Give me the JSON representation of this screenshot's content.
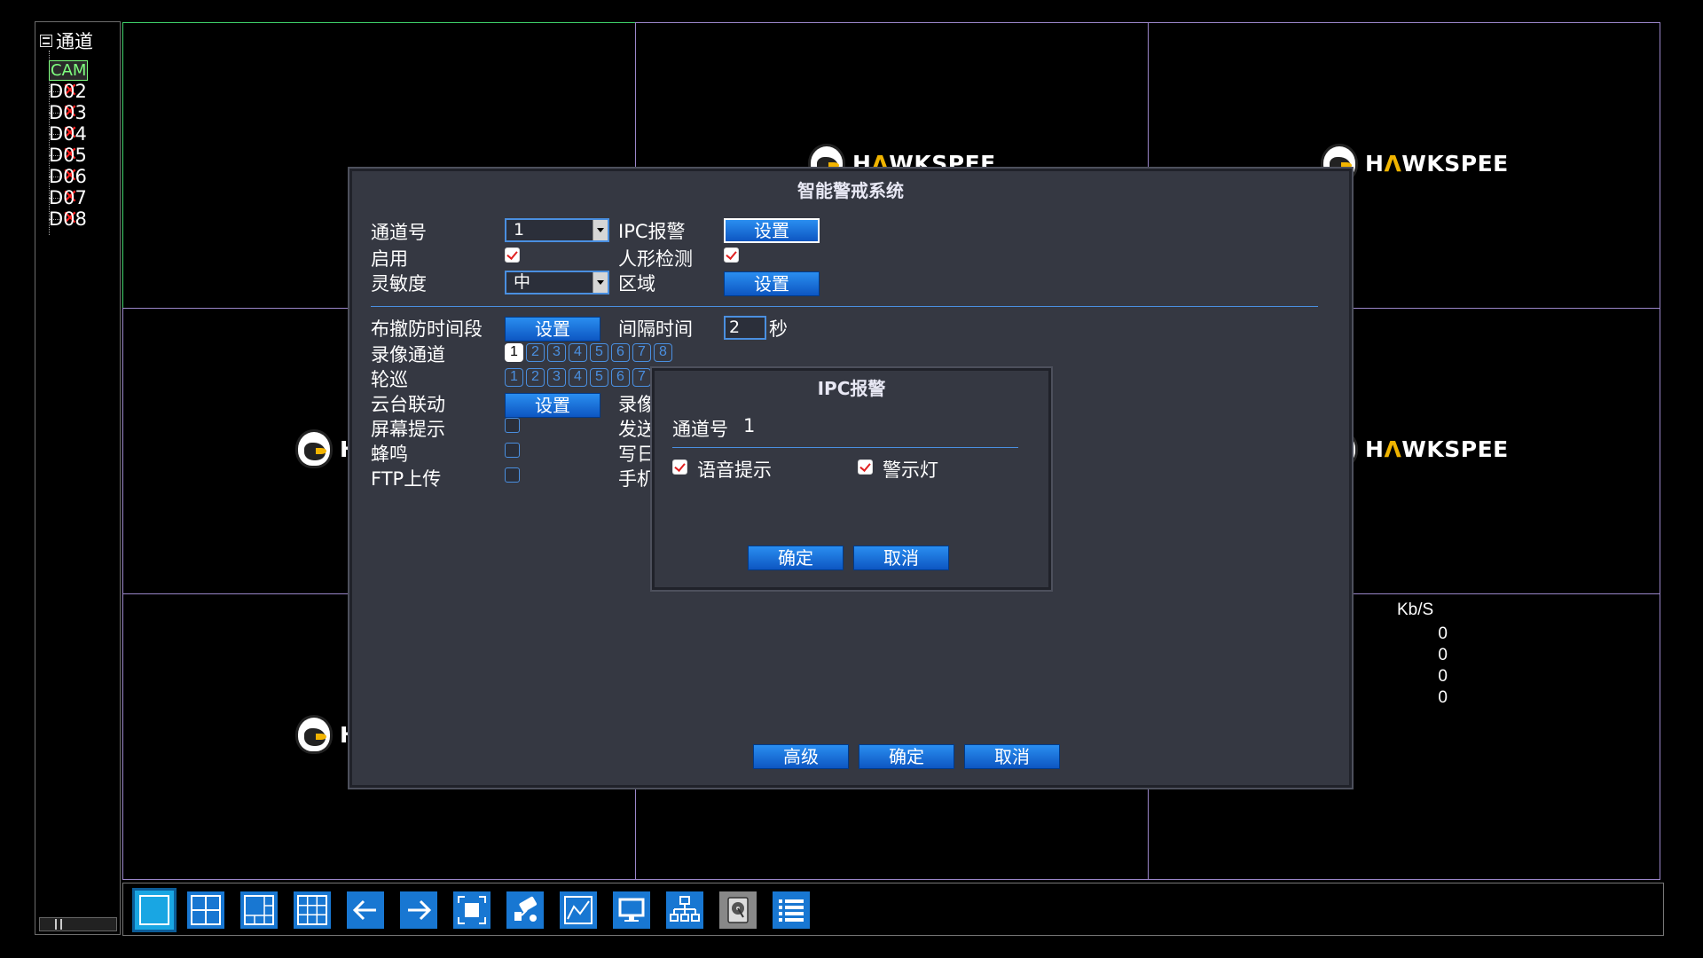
{
  "tree": {
    "root_label": "通道",
    "items": [
      {
        "label": "CAM",
        "status": "selected"
      },
      {
        "label": "D02",
        "status": "disconnected"
      },
      {
        "label": "D03",
        "status": "disconnected"
      },
      {
        "label": "D04",
        "status": "disconnected"
      },
      {
        "label": "D05",
        "status": "disconnected"
      },
      {
        "label": "D06",
        "status": "disconnected"
      },
      {
        "label": "D07",
        "status": "disconnected"
      },
      {
        "label": "D08",
        "status": "disconnected"
      }
    ]
  },
  "grid": {
    "logo_text_main": "HAWKSPEE",
    "logo_text_A": "Λ",
    "logo_text_pre": "H",
    "logo_text_post": "WKSPEE",
    "logo_partial": "H"
  },
  "kbs": {
    "title": "Kb/S",
    "values": [
      "0",
      "0",
      "0",
      "0"
    ]
  },
  "toolbar": {
    "buttons": [
      "single-view",
      "quad-view",
      "multi-view-6",
      "nine-view",
      "previous",
      "next",
      "fullscreen",
      "ptz",
      "chart",
      "monitor",
      "network",
      "hdd",
      "list"
    ]
  },
  "dialog": {
    "title": "智能警戒系统",
    "channel_label": "通道号",
    "channel_value": "1",
    "ipc_alarm_label": "IPC报警",
    "set_label": "设置",
    "enable_label": "启用",
    "enable_checked": true,
    "human_detect_label": "人形检测",
    "human_detect_checked": true,
    "sensitivity_label": "灵敏度",
    "sensitivity_value": "中",
    "region_label": "区域",
    "schedule_label": "布撤防时间段",
    "interval_label": "间隔时间",
    "interval_value": "2",
    "interval_unit": "秒",
    "record_channel_label": "录像通道",
    "tour_label": "轮巡",
    "ptz_link_label": "云台联动",
    "record_partial": "录像",
    "screen_tip_label": "屏幕提示",
    "send_partial": "发送",
    "buzzer_label": "蜂鸣",
    "write_partial": "写日",
    "ftp_label": "FTP上传",
    "phone_partial": "手机",
    "channel_numbers": [
      "1",
      "2",
      "3",
      "4",
      "5",
      "6",
      "7",
      "8"
    ],
    "tour_numbers": [
      "1",
      "2",
      "3",
      "4",
      "5",
      "6",
      "7"
    ],
    "advanced_label": "高级",
    "ok_label": "确定",
    "cancel_label": "取消"
  },
  "sub": {
    "title": "IPC报警",
    "channel_label": "通道号",
    "channel_value": "1",
    "voice_label": "语音提示",
    "voice_checked": true,
    "light_label": "警示灯",
    "light_checked": true,
    "ok_label": "确定",
    "cancel_label": "取消"
  },
  "colors": {
    "accent": "#1877d2",
    "dialog_bg": "#353842",
    "grid_border": "#9a86c9",
    "active_border": "#3fd16a",
    "error": "#ff2020",
    "selected": "#7fff7f"
  }
}
